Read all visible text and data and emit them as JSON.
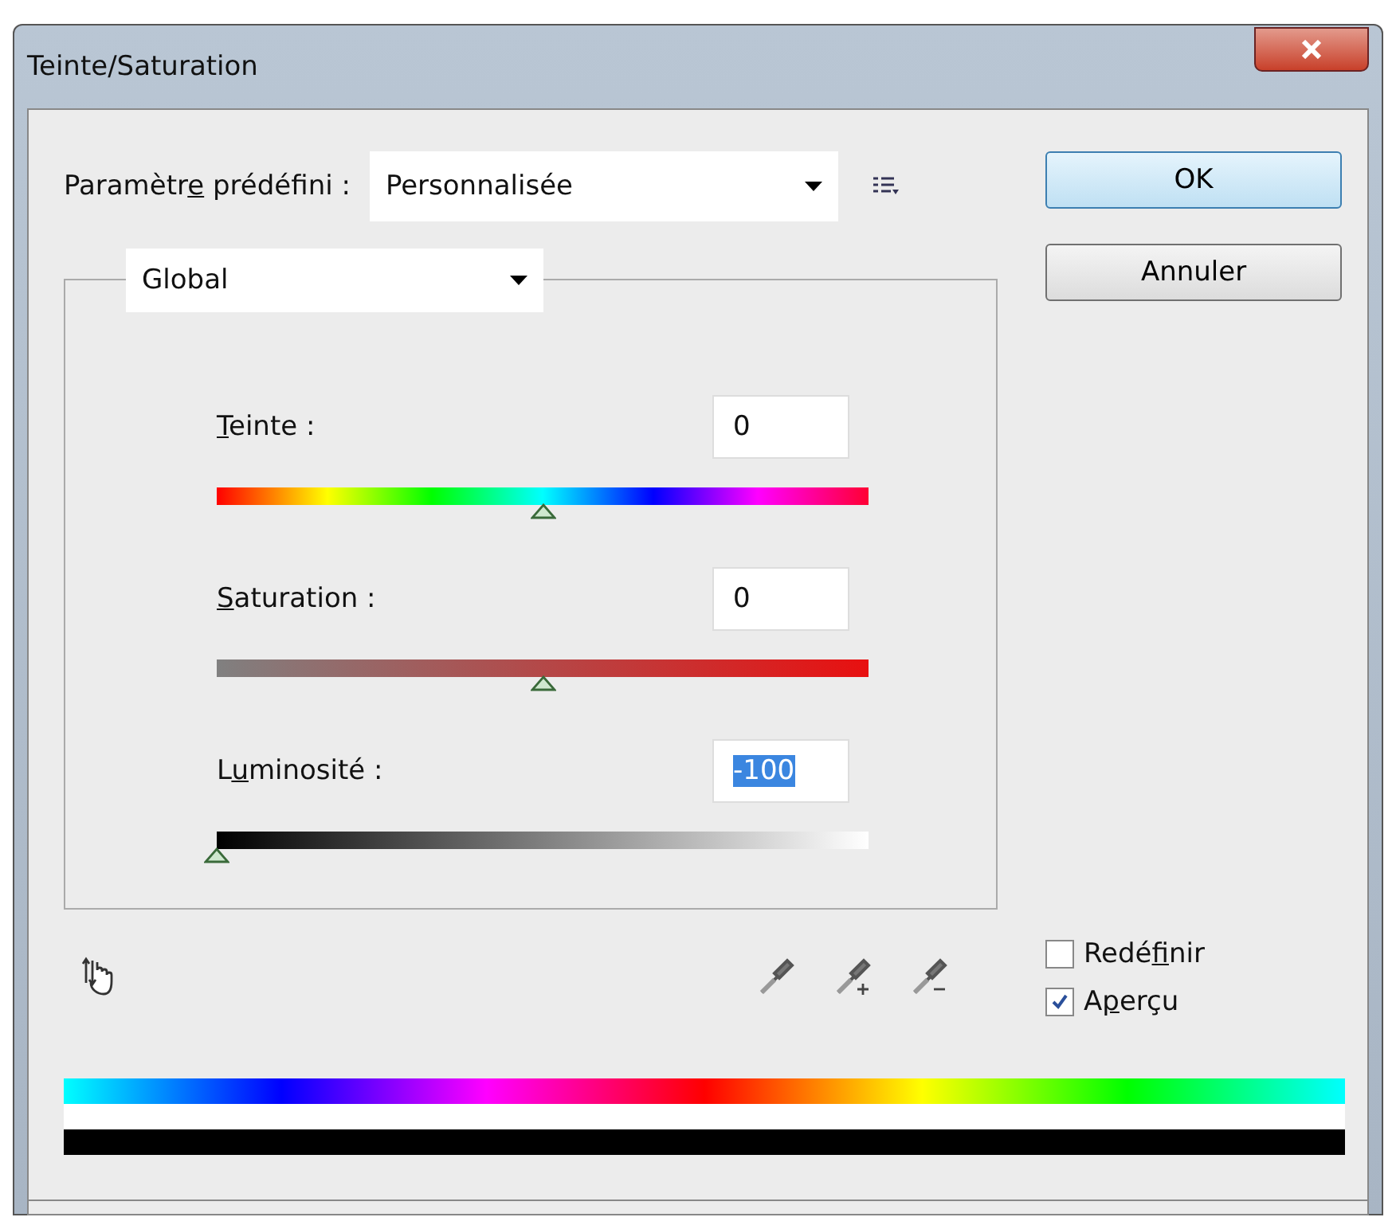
{
  "window": {
    "title": "Teinte/Saturation"
  },
  "preset": {
    "label": {
      "before": "Paramètr",
      "key": "e",
      "after": " prédéfini :"
    },
    "value": "Personnalisée"
  },
  "buttons": [
    {
      "label": "OK",
      "default": true
    },
    {
      "label": "Annuler",
      "default": false
    }
  ],
  "channel": {
    "value": "Global"
  },
  "sliders": [
    {
      "kind": "hue",
      "label": {
        "key": "T",
        "after": "einte :"
      },
      "value": "0",
      "selected": false,
      "level": 0.5
    },
    {
      "kind": "saturation",
      "label": {
        "key": "S",
        "after": "aturation :"
      },
      "value": "0",
      "selected": false,
      "level": 0.5
    },
    {
      "kind": "lightness",
      "label": {
        "before": "L",
        "key": "u",
        "after": "minosité :"
      },
      "value": "-100",
      "selected": true,
      "level": 0
    }
  ],
  "options": [
    {
      "label": {
        "before": "Redé",
        "key": "f",
        "after": "inir"
      },
      "checked": false
    },
    {
      "label": {
        "before": "A",
        "key": "p",
        "after": "erçu"
      },
      "checked": true
    }
  ]
}
